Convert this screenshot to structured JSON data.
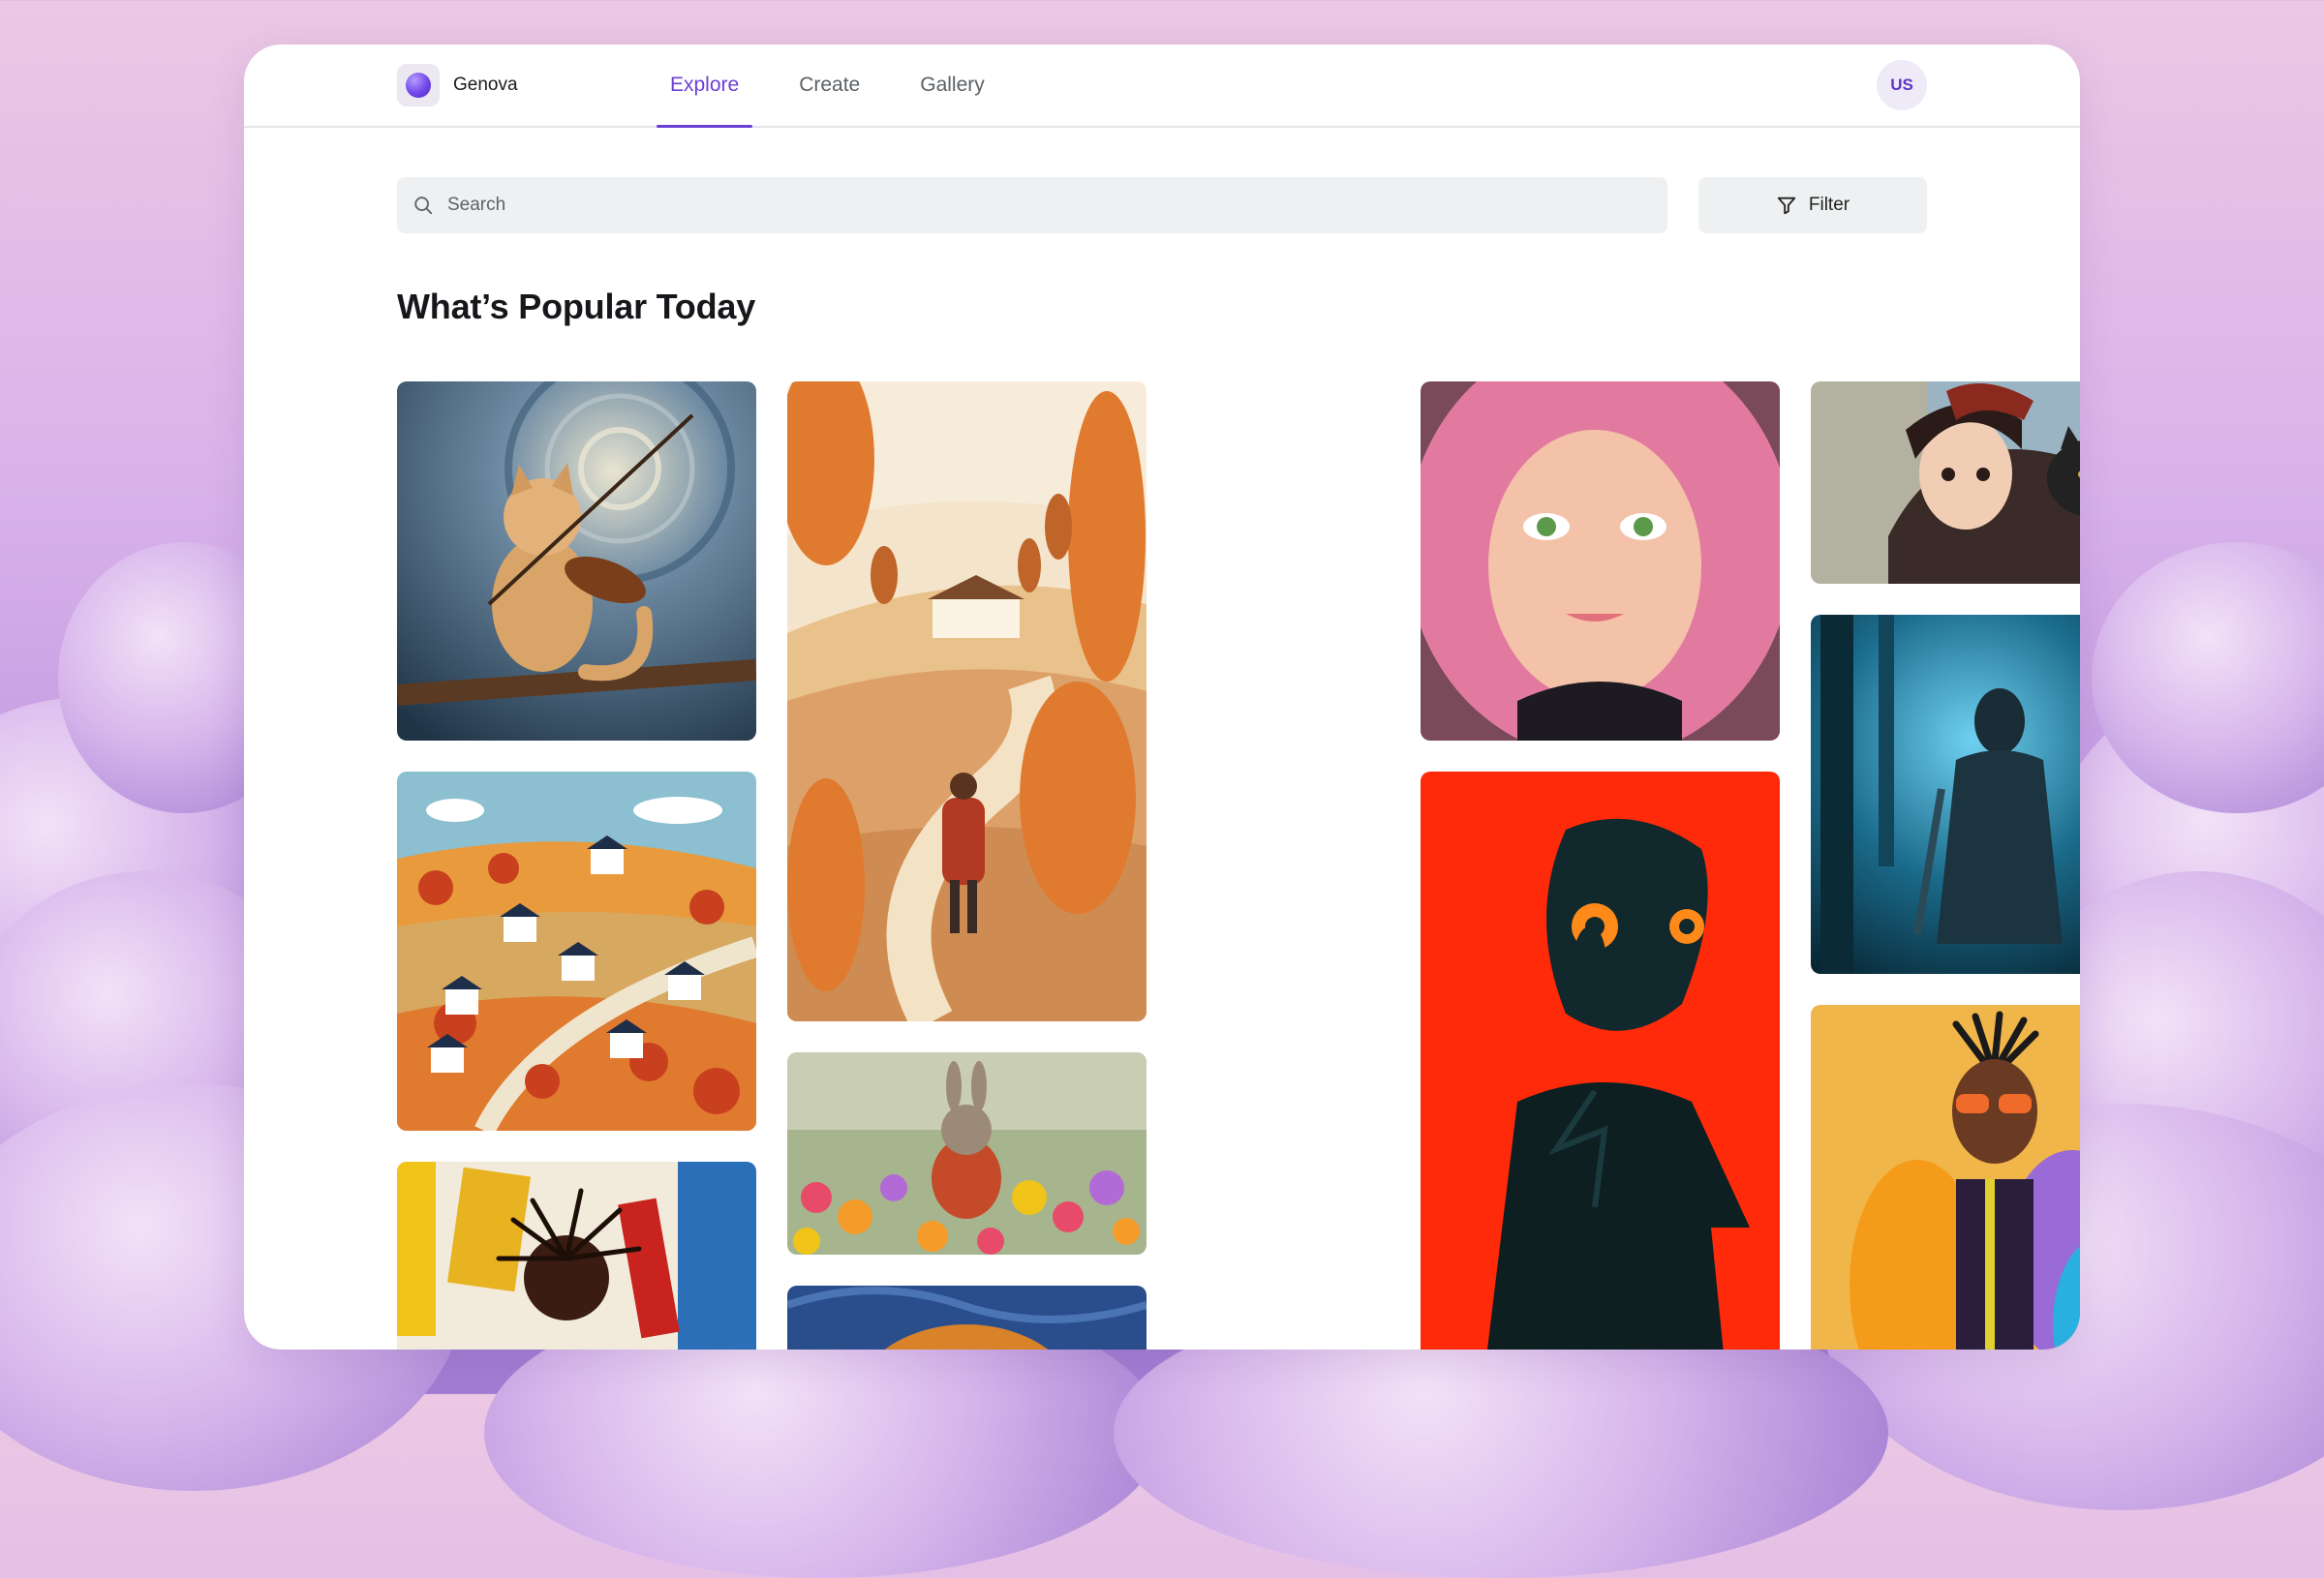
{
  "app": {
    "name": "Genova"
  },
  "nav": {
    "tabs": [
      {
        "label": "Explore"
      },
      {
        "label": "Create"
      },
      {
        "label": "Gallery"
      }
    ],
    "active": "Explore"
  },
  "user": {
    "initials": "US"
  },
  "search": {
    "placeholder": "Search",
    "value": ""
  },
  "filter": {
    "label": "Filter"
  },
  "section": {
    "title": "What’s Popular Today"
  },
  "colors": {
    "accent": "#6a3fd6",
    "surface": "#eef0f1"
  },
  "gallery": {
    "items": [
      {
        "subject": "cat playing violin, swirling starry sky"
      },
      {
        "subject": "autumn village hills with houses"
      },
      {
        "subject": "dancer with dreadlocks, abstract paint"
      },
      {
        "subject": "woman walking autumn path with house"
      },
      {
        "subject": "bunny in sweater among flowers"
      },
      {
        "subject": "portrait with red hair, painterly"
      },
      {
        "subject": "girl with pink hair and freckles"
      },
      {
        "subject": "silhouette man with glowing eyes on red"
      },
      {
        "subject": "girl with cat, flying"
      },
      {
        "subject": "armored knight in blue forest"
      },
      {
        "subject": "stylized character in puffer jacket"
      }
    ]
  }
}
